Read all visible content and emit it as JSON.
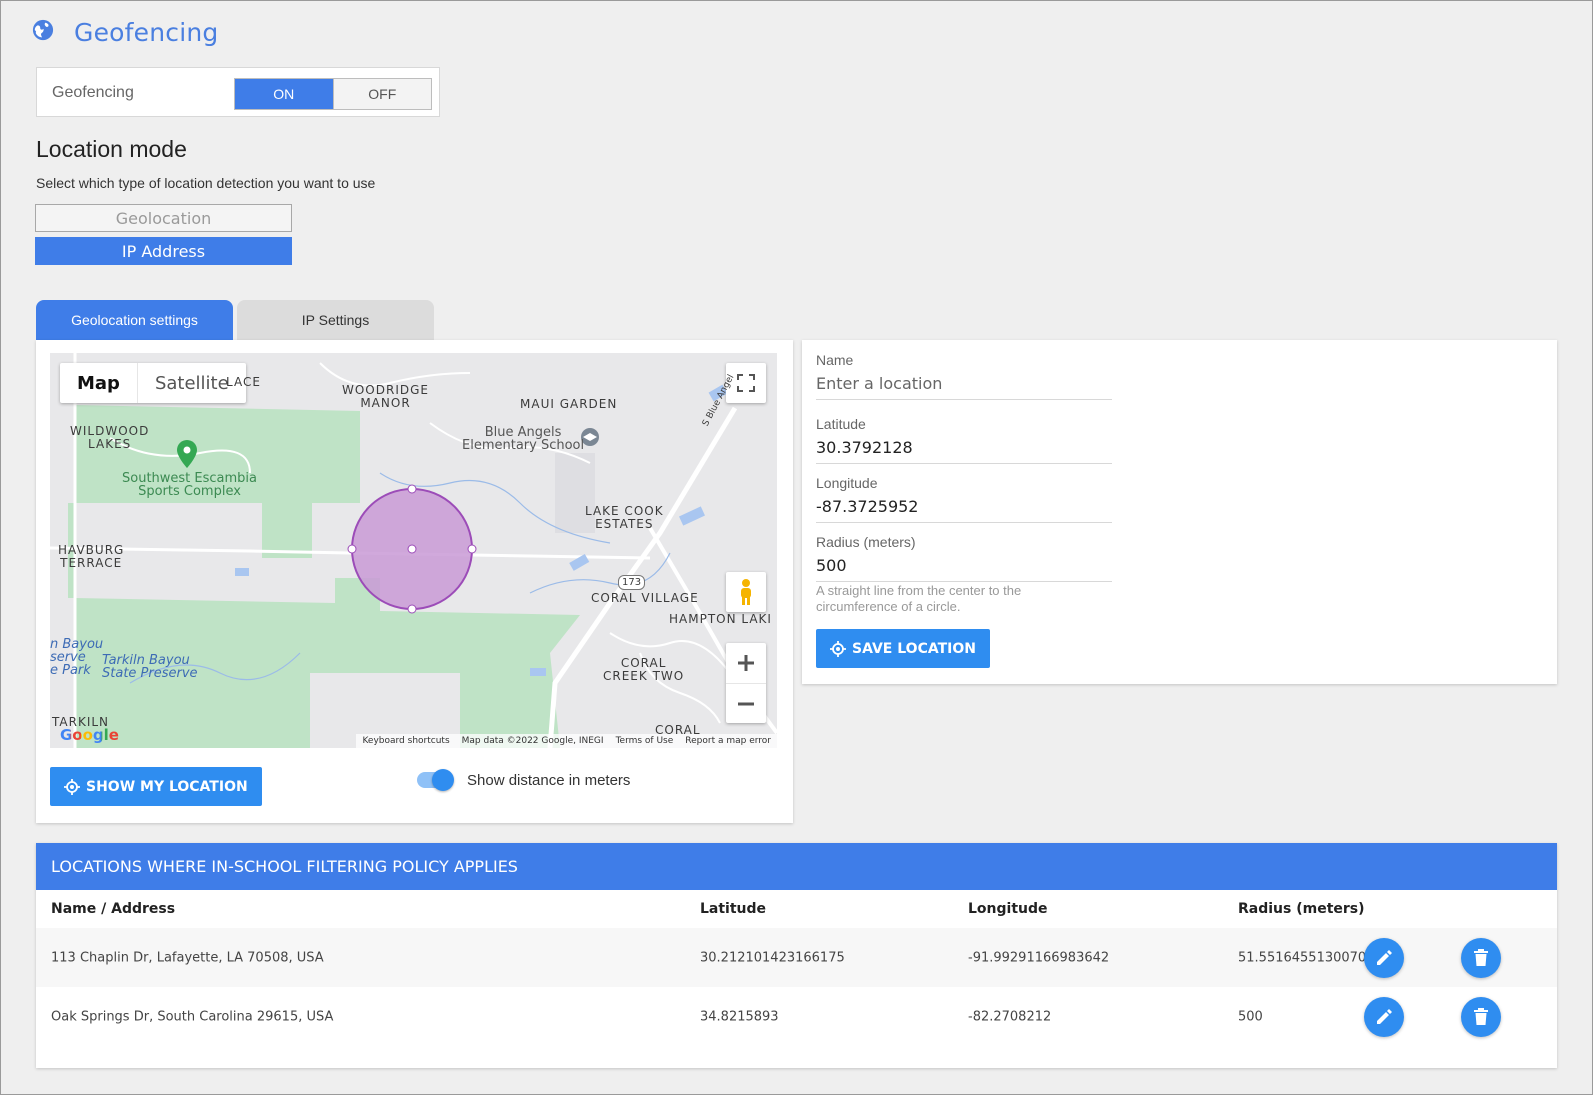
{
  "header": {
    "title": "Geofencing",
    "icon": "globe-icon"
  },
  "geofencing": {
    "label": "Geofencing",
    "on_label": "ON",
    "off_label": "OFF",
    "selected": "ON"
  },
  "location_mode": {
    "title": "Location mode",
    "subtitle": "Select which type of location detection you want to use",
    "options": [
      "Geolocation",
      "IP Address"
    ],
    "selected": "IP Address"
  },
  "tabs": [
    {
      "label": "Geolocation settings",
      "active": true
    },
    {
      "label": "IP Settings",
      "active": false
    }
  ],
  "map": {
    "type_map": "Map",
    "type_satellite": "Satellite",
    "labels": {
      "lace": "LACE",
      "woodridge": "WOODRIDGE\nMANOR",
      "maui": "MAUI GARDEN",
      "wildwood": "WILDWOOD\nLAKES",
      "blue_angels": "Blue Angels\nElementary School",
      "sw_escambia": "Southwest Escambia\nSports Complex",
      "lake_cook": "LAKE COOK\nESTATES",
      "havburg": "HAVBURG\nTERRACE",
      "coral_village": "CORAL VILLAGE",
      "hampton": "HAMPTON LAKI",
      "coral_creek": "CORAL\nCREEK TWO",
      "bayou_reserve": "n Bayou\nserve\ne Park",
      "tarkiln_bayou": "Tarkiln Bayou\nState Preserve",
      "tarkiln": "TARKILN",
      "road_173": "173",
      "blue_angel_road": "S Blue Angel",
      "coral_bottom": "CORAL"
    },
    "footer": {
      "shortcuts": "Keyboard shortcuts",
      "data": "Map data ©2022 Google, INEGI",
      "terms": "Terms of Use",
      "report": "Report a map error"
    },
    "logo": "Google"
  },
  "show_location_button": "SHOW MY LOCATION",
  "distance_toggle": {
    "label": "Show distance in meters",
    "on": true
  },
  "form": {
    "name_label": "Name",
    "name_placeholder": "Enter a location",
    "latitude_label": "Latitude",
    "latitude_value": "30.3792128",
    "longitude_label": "Longitude",
    "longitude_value": "-87.3725952",
    "radius_label": "Radius (meters)",
    "radius_value": "500",
    "radius_hint": "A straight line from the center to the circumference of a circle.",
    "save_button": "SAVE LOCATION"
  },
  "table": {
    "title": "LOCATIONS WHERE IN-SCHOOL FILTERING POLICY APPLIES",
    "columns": [
      "Name / Address",
      "Latitude",
      "Longitude",
      "Radius (meters)"
    ],
    "rows": [
      {
        "name": "113 Chaplin Dr, Lafayette, LA 70508, USA",
        "latitude": "30.212101423166175",
        "longitude": "-91.99291166983642",
        "radius": "51.551645513007045"
      },
      {
        "name": "Oak Springs Dr, South Carolina 29615, USA",
        "latitude": "34.8215893",
        "longitude": "-82.2708212",
        "radius": "500"
      }
    ]
  },
  "colors": {
    "primary": "#3f7de8",
    "action": "#2f8df0",
    "geofence": "#c99ad6"
  }
}
